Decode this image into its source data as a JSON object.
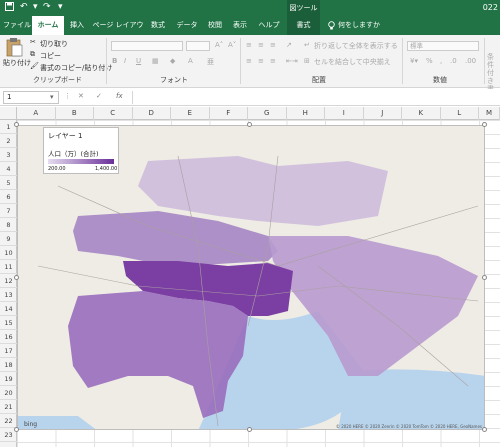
{
  "titlebar": {
    "context_tool": "図ツール",
    "filename": "022",
    "quick_access": [
      "save-icon",
      "undo-icon",
      "redo-icon",
      "customize-icon"
    ]
  },
  "tabs": [
    "ファイル",
    "ホーム",
    "挿入",
    "ページ レイアウト",
    "数式",
    "データ",
    "校閲",
    "表示",
    "ヘルプ",
    "書式"
  ],
  "tell_me": "何をしますか",
  "ribbon": {
    "paste": "貼り付け",
    "cut": "切り取り",
    "copy": "コピー",
    "format_painter": "書式のコピー/貼り付け",
    "clipboard_label": "クリップボード",
    "font_label": "フォント",
    "alignment_label": "配置",
    "wrap_text": "折り返して全体を表示する",
    "merge_center": "セルを結合して中央揃え",
    "number_label": "数値",
    "number_format": "標準",
    "conditional": "条件付き書式"
  },
  "formulabar": {
    "namebox": "1",
    "fx": "fx"
  },
  "columns": [
    "A",
    "B",
    "C",
    "D",
    "E",
    "F",
    "G",
    "H",
    "I",
    "J",
    "K",
    "L",
    "M"
  ],
  "rows": [
    "1",
    "2",
    "3",
    "4",
    "5",
    "6",
    "7",
    "8",
    "9",
    "10",
    "11",
    "12",
    "13",
    "14",
    "15",
    "16",
    "17",
    "18",
    "19",
    "20",
    "21",
    "22",
    "23"
  ],
  "map": {
    "legend_title": "レイヤー 1",
    "legend_subtitle": "人口（万）(合計)",
    "legend_min": "200.00",
    "legend_max": "1,400.00",
    "bing": "bing",
    "attribution": "© 2020 HERE  © 2020 Zenrin  © 2020 TomTom  © 2020 HERE, GeoNames",
    "colors": {
      "tokyo": "#7b3ea3",
      "kanagawa": "#9a70be",
      "saitama": "#a586c4",
      "chiba": "#b89bcf",
      "north": "#cbbadc",
      "water": "#b8d4ec"
    }
  }
}
